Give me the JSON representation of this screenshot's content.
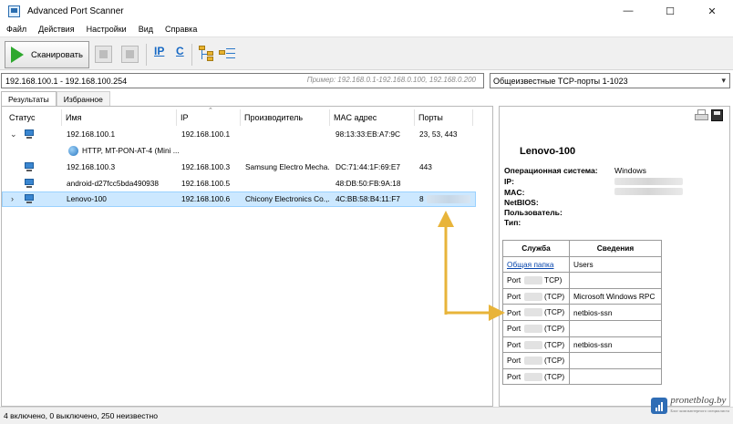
{
  "window": {
    "title": "Advanced Port Scanner",
    "minimize": "—",
    "maximize": "☐",
    "close": "✕"
  },
  "menu": [
    "Файл",
    "Действия",
    "Настройки",
    "Вид",
    "Справка"
  ],
  "toolbar": {
    "scan_label": "Сканировать",
    "ip_label": "IP",
    "c_label": "C"
  },
  "range": {
    "value": "192.168.100.1 - 192.168.100.254",
    "example": "Пример: 192.168.0.1-192.168.0.100, 192.168.0.200"
  },
  "ports_select": {
    "value": "Общеизвестные TCP-порты 1-1023"
  },
  "tabs": [
    "Результаты",
    "Избранное"
  ],
  "columns": [
    "Статус",
    "Имя",
    "IP",
    "Производитель",
    "MAC адрес",
    "Порты"
  ],
  "rows": [
    {
      "expander": "⌄",
      "icon": "computer-icon",
      "name": "192.168.100.1",
      "ip": "192.168.100.1",
      "vendor": "",
      "mac": "98:13:33:EB:A7:9C",
      "ports": "23, 53, 443"
    },
    {
      "child": true,
      "icon": "globe-icon",
      "name": "HTTP, MT-PON-AT-4 (Mini ..."
    },
    {
      "icon": "computer-icon",
      "name": "192.168.100.3",
      "ip": "192.168.100.3",
      "vendor": "Samsung Electro Mecha...",
      "mac": "DC:71:44:1F:69:E7",
      "ports": "443"
    },
    {
      "icon": "computer-icon",
      "name": "android-d27fcc5bda490938",
      "ip": "192.168.100.5",
      "vendor": "",
      "mac": "48:DB:50:FB:9A:18",
      "ports": ""
    },
    {
      "expander": "›",
      "icon": "computer-icon",
      "name": "Lenovo-100",
      "ip": "192.168.100.6",
      "vendor": "Chicony Electronics Co.,...",
      "mac": "4C:BB:58:B4:11:F7",
      "ports": "8",
      "selected": true
    }
  ],
  "details": {
    "title": "Lenovo-100",
    "fields": [
      {
        "label": "Операционная система:",
        "value": "Windows"
      },
      {
        "label": "IP:",
        "value": ""
      },
      {
        "label": "MAC:",
        "value": ""
      },
      {
        "label": "NetBIOS:",
        "value": ""
      },
      {
        "label": "Пользователь:",
        "value": ""
      },
      {
        "label": "Тип:",
        "value": ""
      }
    ],
    "table_headers": [
      "Служба",
      "Сведения"
    ],
    "services": [
      {
        "service": "Общая папка",
        "link": true,
        "info": "Users"
      },
      {
        "service": "Port",
        "proto": "TCP)",
        "info": ""
      },
      {
        "service": "Port",
        "proto": "(TCP)",
        "info": "Microsoft Windows RPC"
      },
      {
        "service": "Port",
        "proto": "(TCP)",
        "info": "netbios-ssn"
      },
      {
        "service": "Port",
        "proto": "(TCP)",
        "info": ""
      },
      {
        "service": "Port",
        "proto": "(TCP)",
        "info": "netbios-ssn"
      },
      {
        "service": "Port",
        "proto": "(TCP)",
        "info": ""
      },
      {
        "service": "Port",
        "proto": "(TCP)",
        "info": ""
      }
    ]
  },
  "status": "4 включено, 0 выключено, 250 неизвестно",
  "watermark": {
    "name": "pronetblog.by",
    "tagline": "Блог компьютерного специалиста"
  },
  "colors": {
    "selection": "#cce8ff",
    "arrow": "#e8b43a",
    "scan_green": "#2ea82e",
    "accent": "#1769c4"
  }
}
